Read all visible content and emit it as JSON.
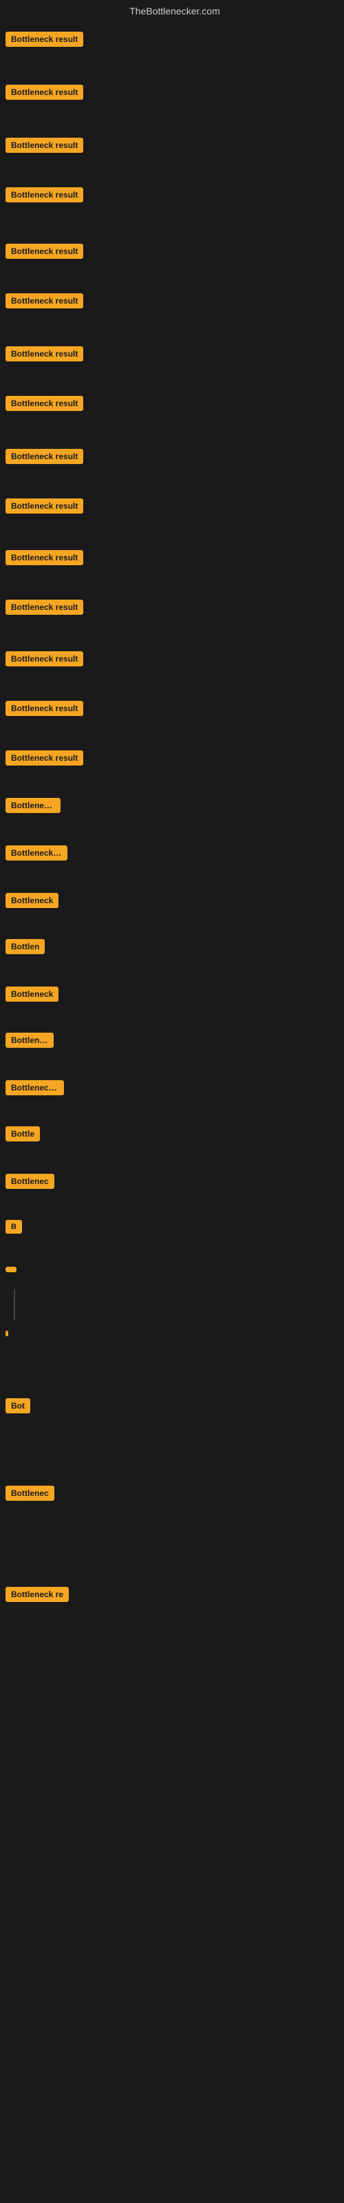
{
  "site": {
    "title": "TheBottlenecker.com"
  },
  "items": [
    {
      "id": 1,
      "label": "Bottleneck result"
    },
    {
      "id": 2,
      "label": "Bottleneck result"
    },
    {
      "id": 3,
      "label": "Bottleneck result"
    },
    {
      "id": 4,
      "label": "Bottleneck result"
    },
    {
      "id": 5,
      "label": "Bottleneck result"
    },
    {
      "id": 6,
      "label": "Bottleneck result"
    },
    {
      "id": 7,
      "label": "Bottleneck result"
    },
    {
      "id": 8,
      "label": "Bottleneck result"
    },
    {
      "id": 9,
      "label": "Bottleneck result"
    },
    {
      "id": 10,
      "label": "Bottleneck result"
    },
    {
      "id": 11,
      "label": "Bottleneck result"
    },
    {
      "id": 12,
      "label": "Bottleneck result"
    },
    {
      "id": 13,
      "label": "Bottleneck result"
    },
    {
      "id": 14,
      "label": "Bottleneck result"
    },
    {
      "id": 15,
      "label": "Bottleneck result"
    },
    {
      "id": 16,
      "label": "Bottleneck r"
    },
    {
      "id": 17,
      "label": "Bottleneck resu"
    },
    {
      "id": 18,
      "label": "Bottleneck"
    },
    {
      "id": 19,
      "label": "Bottlen"
    },
    {
      "id": 20,
      "label": "Bottleneck"
    },
    {
      "id": 21,
      "label": "Bottlenec"
    },
    {
      "id": 22,
      "label": "Bottleneck re"
    },
    {
      "id": 23,
      "label": "Bottle"
    },
    {
      "id": 24,
      "label": "Bottlenec"
    },
    {
      "id": 25,
      "label": "B"
    },
    {
      "id": 26,
      "label": ""
    },
    {
      "id": 27,
      "label": ""
    },
    {
      "id": 28,
      "label": "Bot"
    },
    {
      "id": 29,
      "label": "Bottlenec"
    },
    {
      "id": 30,
      "label": "Bottleneck re"
    }
  ]
}
